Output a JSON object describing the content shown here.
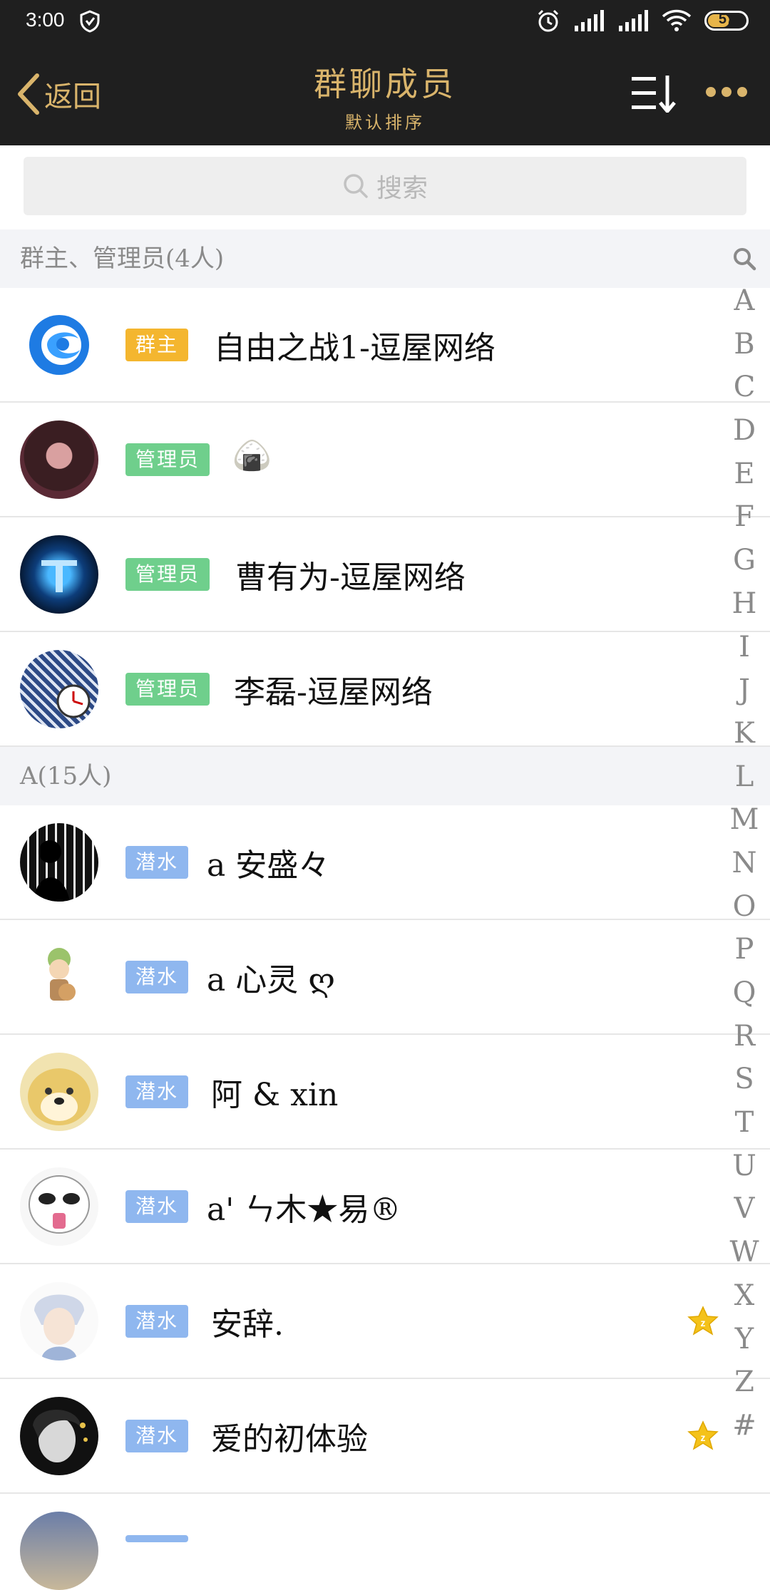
{
  "status_bar": {
    "time": "3:00",
    "battery": "57"
  },
  "header": {
    "back_label": "返回",
    "title": "群聊成员",
    "subtitle": "默认排序"
  },
  "search": {
    "placeholder": "搜索"
  },
  "sections": [
    {
      "header": "群主、管理员(4人)"
    },
    {
      "header": "A(15人)"
    }
  ],
  "members": [
    {
      "badge": "群主",
      "name": "自由之战1-逗屋网络",
      "avatar": "blue-swirl-logo"
    },
    {
      "badge": "管理员",
      "name": "🍙",
      "avatar": "girl-portrait"
    },
    {
      "badge": "管理员",
      "name": "曹有为-逗屋网络",
      "avatar": "game-emblem"
    },
    {
      "badge": "管理员",
      "name": "李磊-逗屋网络",
      "avatar": "building-clock"
    },
    {
      "badge": "潜水",
      "name": "a  安盛々",
      "avatar": "bw-figure"
    },
    {
      "badge": "潜水",
      "name": "a  心灵 ღ",
      "avatar": "cartoon-character"
    },
    {
      "badge": "潜水",
      "name": "阿 & xin",
      "avatar": "doge"
    },
    {
      "badge": "潜水",
      "name": "a' ㄣ木★易®",
      "avatar": "meme-face"
    },
    {
      "badge": "潜水",
      "name": "安辞.",
      "avatar": "anime-boy"
    },
    {
      "badge": "潜水",
      "name": "爱的初体验",
      "avatar": "woman-portrait"
    }
  ],
  "index_letters": [
    "A",
    "B",
    "C",
    "D",
    "E",
    "F",
    "G",
    "H",
    "I",
    "J",
    "K",
    "L",
    "M",
    "N",
    "O",
    "P",
    "Q",
    "R",
    "S",
    "T",
    "U",
    "V",
    "W",
    "X",
    "Y",
    "Z",
    "#"
  ],
  "colors": {
    "accent": "#d9b46b",
    "header_bg": "#1f1f1f",
    "owner": "#f4b62f",
    "admin": "#6fcf8c",
    "diver": "#8fb7ef"
  }
}
